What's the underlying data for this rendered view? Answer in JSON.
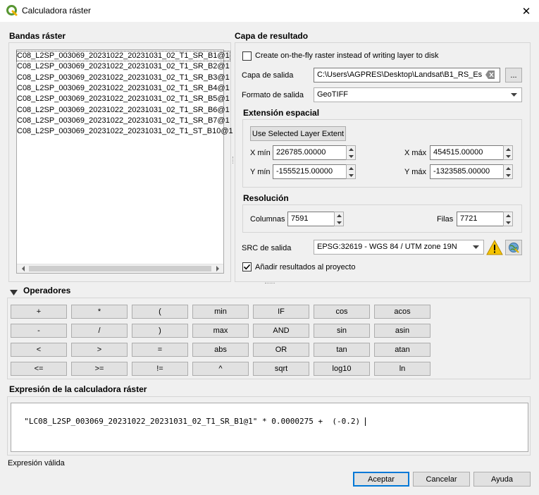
{
  "window": {
    "title": "Calculadora ráster",
    "close_glyph": "✕",
    "icon": "qgis-logo-icon"
  },
  "bands": {
    "section_title": "Bandas ráster",
    "items": [
      "C08_L2SP_003069_20231022_20231031_02_T1_SR_B1@1",
      "C08_L2SP_003069_20231022_20231031_02_T1_SR_B2@1",
      "C08_L2SP_003069_20231022_20231031_02_T1_SR_B3@1",
      "C08_L2SP_003069_20231022_20231031_02_T1_SR_B4@1",
      "C08_L2SP_003069_20231022_20231031_02_T1_SR_B5@1",
      "C08_L2SP_003069_20231022_20231031_02_T1_SR_B6@1",
      "C08_L2SP_003069_20231022_20231031_02_T1_SR_B7@1",
      "C08_L2SP_003069_20231022_20231031_02_T1_ST_B10@1"
    ]
  },
  "result": {
    "section_title": "Capa de resultado",
    "on_the_fly_label": "Create on-the-fly raster instead of writing layer to disk",
    "on_the_fly_checked": false,
    "output_layer_label": "Capa de salida",
    "output_layer_value": "C:\\Users\\AGPRES\\Desktop\\Landsat\\B1_RS_Es",
    "browse_label": "...",
    "output_format_label": "Formato de salida",
    "output_format_value": "GeoTIFF",
    "extent": {
      "title": "Extensión espacial",
      "use_selected_label": "Use Selected Layer Extent",
      "xmin_label": "X mín",
      "xmin_value": "226785.00000",
      "xmax_label": "X máx",
      "xmax_value": "454515.00000",
      "ymin_label": "Y mín",
      "ymin_value": "-1555215.00000",
      "ymax_label": "Y máx",
      "ymax_value": "-1323585.00000"
    },
    "resolution": {
      "title": "Resolución",
      "columns_label": "Columnas",
      "columns_value": "7591",
      "rows_label": "Filas",
      "rows_value": "7721"
    },
    "crs_label": "SRC de salida",
    "crs_value": "EPSG:32619 - WGS 84 / UTM zone 19N",
    "add_to_project_label": "Añadir resultados al proyecto",
    "add_to_project_checked": true
  },
  "operators": {
    "section_title": "Operadores",
    "rows": [
      [
        "+",
        "*",
        "(",
        "min",
        "IF",
        "cos",
        "acos"
      ],
      [
        "-",
        "/",
        ")",
        "max",
        "AND",
        "sin",
        "asin"
      ],
      [
        "<",
        ">",
        "=",
        "abs",
        "OR",
        "tan",
        "atan"
      ],
      [
        "<=",
        ">=",
        "!=",
        "^",
        "sqrt",
        "log10",
        "ln"
      ]
    ]
  },
  "expression": {
    "section_title": "Expresión de la calculadora ráster",
    "value": "\"LC08_L2SP_003069_20231022_20231031_02_T1_SR_B1@1\" * 0.0000275 +  (-0.2) ",
    "status": "Expresión válida"
  },
  "footer": {
    "ok_label": "Aceptar",
    "cancel_label": "Cancelar",
    "help_label": "Ayuda"
  },
  "colors": {
    "warning": "#f5c400",
    "accent": "#0078d7",
    "qgis_green": "#589632"
  }
}
